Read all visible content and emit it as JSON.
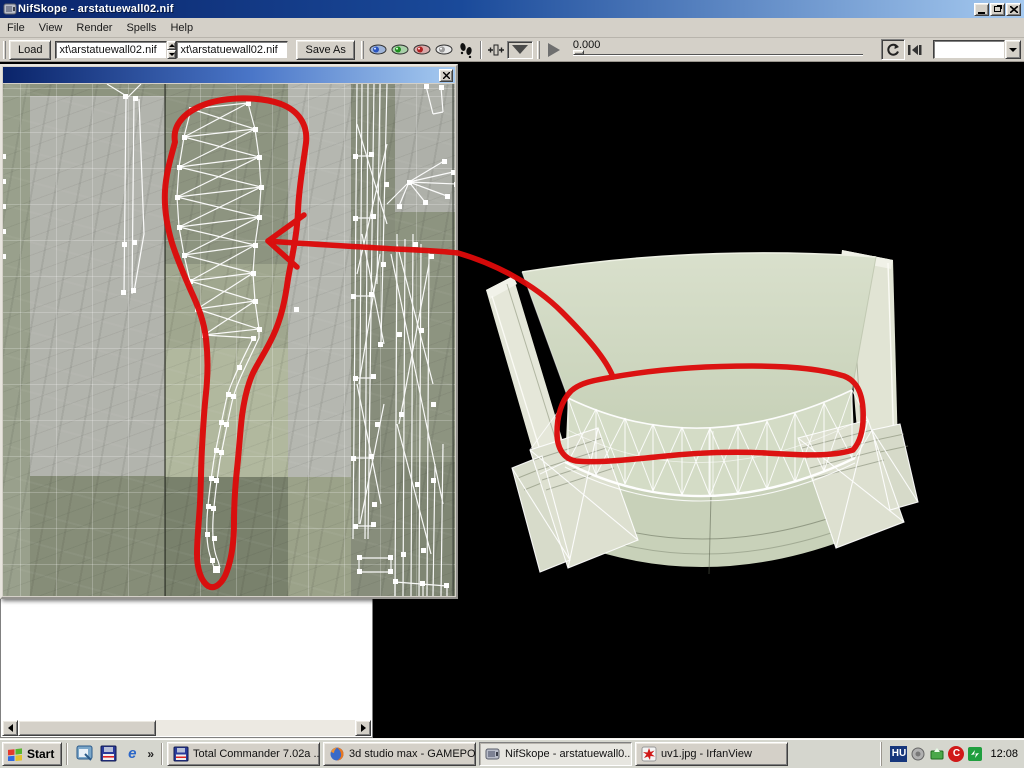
{
  "window": {
    "title": "NifSkope - arstatuewall02.nif"
  },
  "menu": {
    "items": [
      {
        "label": "File"
      },
      {
        "label": "View"
      },
      {
        "label": "Render"
      },
      {
        "label": "Spells"
      },
      {
        "label": "Help"
      }
    ]
  },
  "toolbar": {
    "load_label": "Load",
    "file_path_1": "xt\\arstatuewall02.nif",
    "file_path_2": "xt\\arstatuewall02.nif",
    "save_as_label": "Save As",
    "anim_time": "0.000",
    "anim_combo_value": ""
  },
  "uv_editor": {
    "title": ""
  },
  "taskbar": {
    "start_label": "Start",
    "overflow_chevron": "»",
    "tasks": [
      {
        "label": "Total Commander 7.02a ...",
        "icon": "total-commander"
      },
      {
        "label": "3d studio max - GAMEPO...",
        "icon": "firefox"
      },
      {
        "label": "NifSkope - arstatuewall0...",
        "icon": "nifskope",
        "active": true
      },
      {
        "label": "uv1.jpg - IrfanView",
        "icon": "irfanview"
      }
    ],
    "tray": {
      "language": "HU",
      "security_letter": "C",
      "clock": "12:08"
    }
  },
  "icons": {
    "ie_glyph": "e"
  },
  "colors": {
    "annotation_red": "#dc0a0a",
    "titlebar_start": "#0a246a",
    "titlebar_end": "#a6caf0",
    "taskbar_bg": "#d5d6ce",
    "mesh_wire": "#ffffff"
  }
}
